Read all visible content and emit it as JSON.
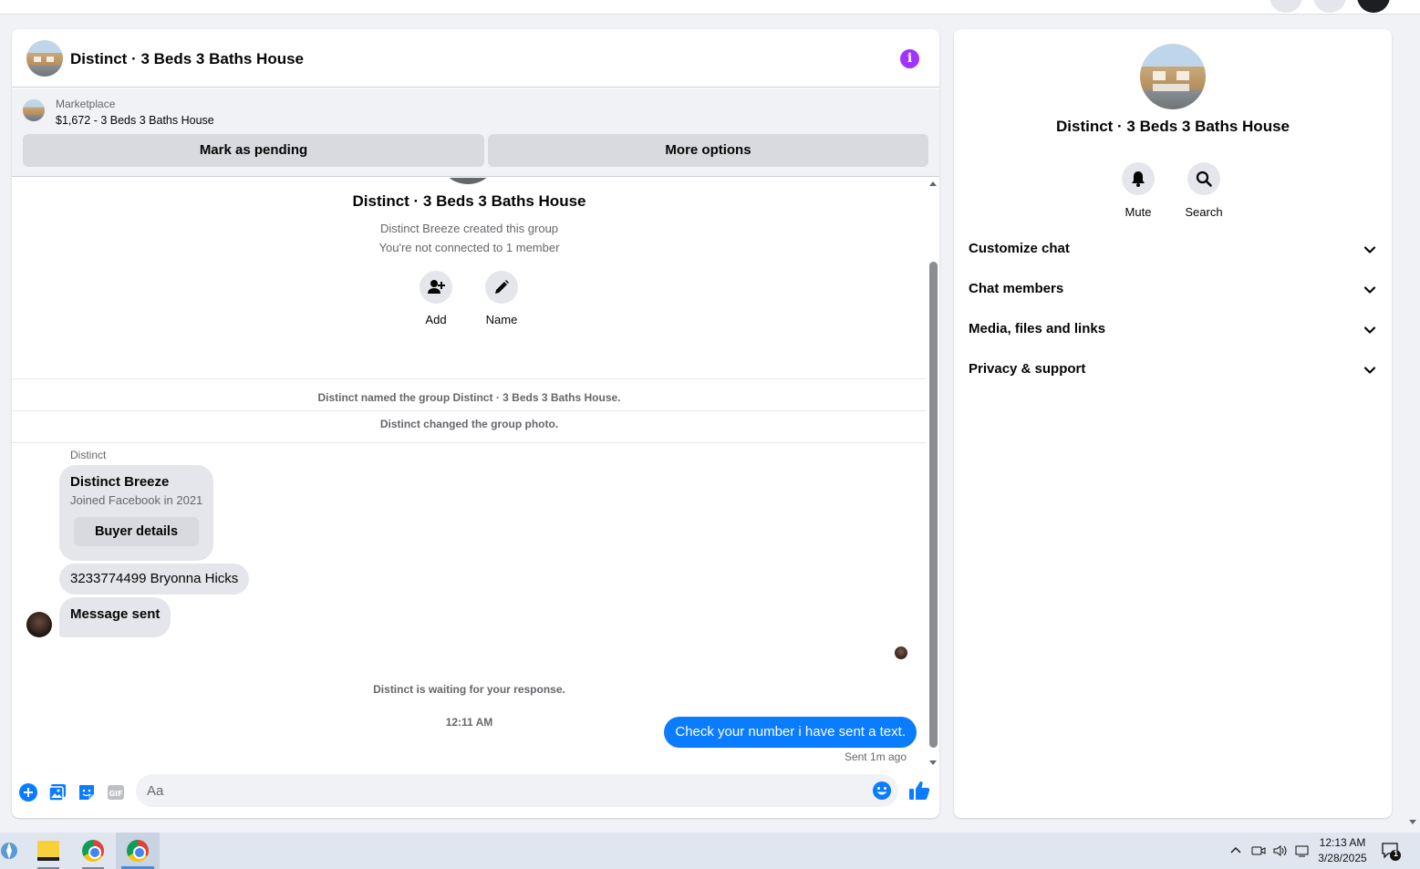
{
  "chat": {
    "title": "Distinct · 3 Beds 3 Baths House",
    "marketplace": {
      "label": "Marketplace",
      "listing": "$1,672 - 3 Beds 3 Baths House",
      "mark_pending_label": "Mark as pending",
      "more_options_label": "More options"
    },
    "group": {
      "title": "Distinct · 3 Beds 3 Baths House",
      "created_by": "Distinct Breeze created this group",
      "connection": "You're not connected to 1 member",
      "add_label": "Add",
      "name_label": "Name"
    },
    "system_messages": [
      "Distinct named the group Distinct · 3 Beds 3 Baths House.",
      "Distinct changed the group photo."
    ],
    "sender_label": "Distinct",
    "buyer_card": {
      "name": "Distinct Breeze",
      "joined": "Joined Facebook in 2021",
      "button_label": "Buyer details"
    },
    "incoming_messages": [
      "3233774499 Bryonna Hicks",
      "Message sent"
    ],
    "waiting_text": "Distinct is waiting for your response.",
    "timestamp": "12:11 AM",
    "outgoing_message": "Check your number i have sent a text.",
    "sent_status": "Sent 1m ago",
    "composer": {
      "placeholder": "Aa"
    }
  },
  "panel": {
    "title": "Distinct · 3 Beds 3 Baths House",
    "mute_label": "Mute",
    "search_label": "Search",
    "sections": [
      "Customize chat",
      "Chat members",
      "Media, files and links",
      "Privacy & support"
    ]
  },
  "taskbar": {
    "time": "12:13 AM",
    "date": "3/28/2025",
    "notification_count": "1"
  },
  "colors": {
    "accent_blue": "#0a7cff",
    "info_purple": "#a033ff",
    "bubble_gray": "#e4e6eb"
  }
}
